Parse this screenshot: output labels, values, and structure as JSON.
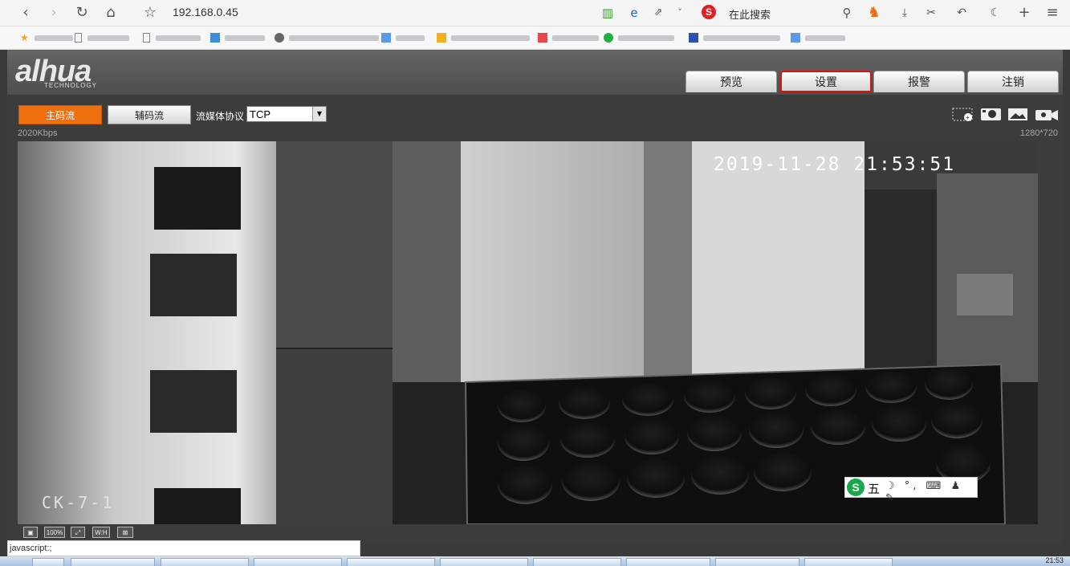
{
  "browser": {
    "url": "192.168.0.45",
    "search_placeholder": "在此搜索",
    "search_logo": "S"
  },
  "bookmarks_count": 12,
  "app": {
    "logo_text": "alhua",
    "logo_sub": "TECHNOLOGY",
    "tabs": [
      {
        "label": "预览",
        "highlighted": false
      },
      {
        "label": "设置",
        "highlighted": true
      },
      {
        "label": "报警",
        "highlighted": false
      },
      {
        "label": "注销",
        "highlighted": false
      }
    ],
    "stream": {
      "main_label": "主码流",
      "sub_label": "辅码流",
      "protocol_label": "流媒体协议",
      "protocol_value": "TCP"
    },
    "bitrate": "2020Kbps",
    "resolution": "1280*720",
    "video": {
      "timestamp": "2019-11-28 21:53:51",
      "camera_name": "CK-7-1"
    },
    "ime": {
      "logo": "S",
      "mode": "五",
      "extras": "☽ °, ⌨ ♟ ✎"
    },
    "bottom_tools": [
      "▣",
      "100%",
      "⤢",
      "W:H",
      "⊠"
    ]
  },
  "status_text": "javascript:;",
  "taskbar_clock": "21:53",
  "colors": {
    "accent": "#f07010",
    "highlight_border": "#e01010",
    "header_bg": "#555555"
  }
}
